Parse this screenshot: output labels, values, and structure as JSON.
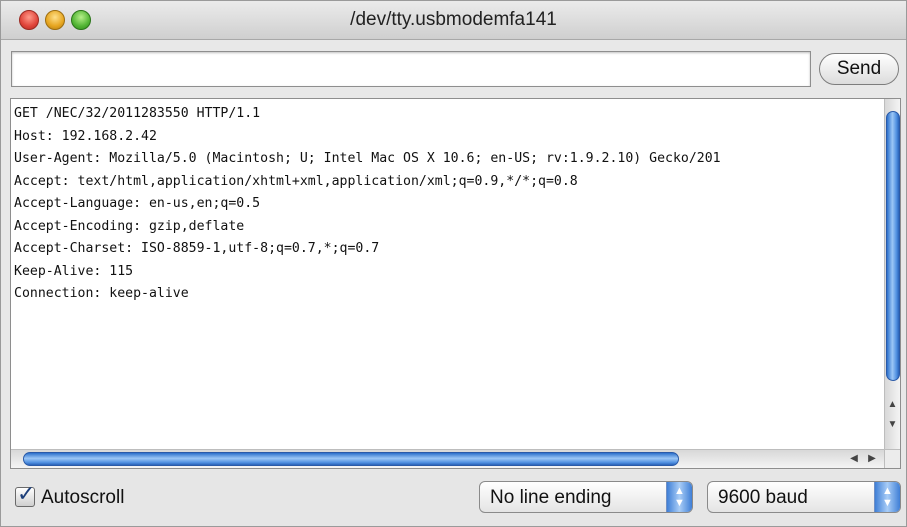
{
  "window": {
    "title": "/dev/tty.usbmodemfa141"
  },
  "send_bar": {
    "input_value": "",
    "send_label": "Send"
  },
  "output": {
    "lines": [
      "GET /NEC/32/2011283550 HTTP/1.1",
      "Host: 192.168.2.42",
      "User-Agent: Mozilla/5.0 (Macintosh; U; Intel Mac OS X 10.6; en-US; rv:1.9.2.10) Gecko/201",
      "Accept: text/html,application/xhtml+xml,application/xml;q=0.9,*/*;q=0.8",
      "Accept-Language: en-us,en;q=0.5",
      "Accept-Encoding: gzip,deflate",
      "Accept-Charset: ISO-8859-1,utf-8;q=0.7,*;q=0.7",
      "Keep-Alive: 115",
      "Connection: keep-alive"
    ]
  },
  "bottom_bar": {
    "autoscroll_label": "Autoscroll",
    "autoscroll_checked": true,
    "line_ending_value": "No line ending",
    "baud_value": "9600 baud"
  },
  "colors": {
    "scroll_thumb": "#4f8fe0",
    "window_bg": "#e8e8e8"
  }
}
